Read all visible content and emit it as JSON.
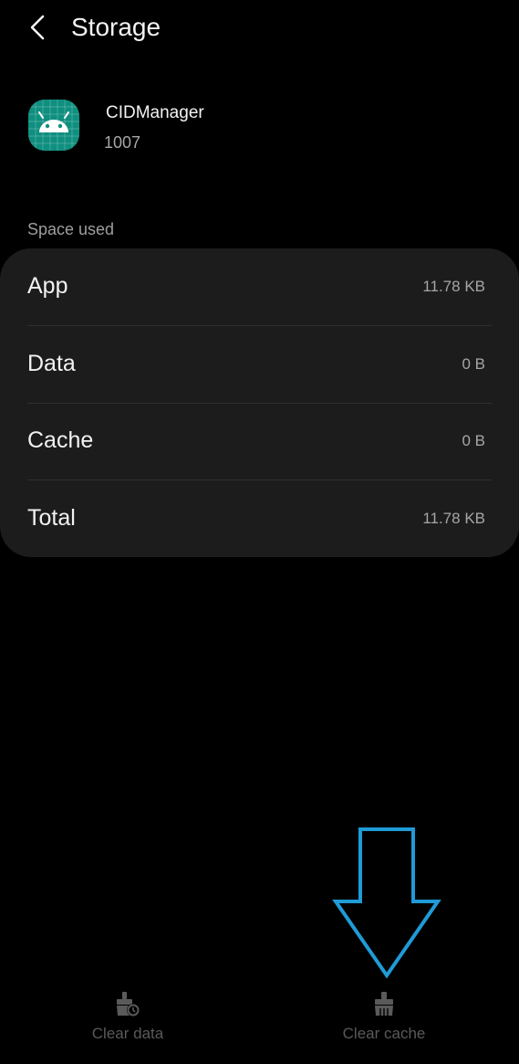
{
  "header": {
    "title": "Storage"
  },
  "app": {
    "name": "CIDManager",
    "uid": "1007",
    "icon": "android-robot-icon",
    "icon_color": "#0f8f7f"
  },
  "section": {
    "label": "Space used"
  },
  "storage_rows": [
    {
      "label": "App",
      "value": "11.78 KB"
    },
    {
      "label": "Data",
      "value": "0 B"
    },
    {
      "label": "Cache",
      "value": "0 B"
    },
    {
      "label": "Total",
      "value": "11.78 KB"
    }
  ],
  "actions": {
    "clear_data": "Clear data",
    "clear_cache": "Clear cache"
  },
  "colors": {
    "background": "#000000",
    "card": "#1c1c1c",
    "annotation_arrow": "#1f9bd7",
    "disabled_action": "#5a5a5a"
  }
}
